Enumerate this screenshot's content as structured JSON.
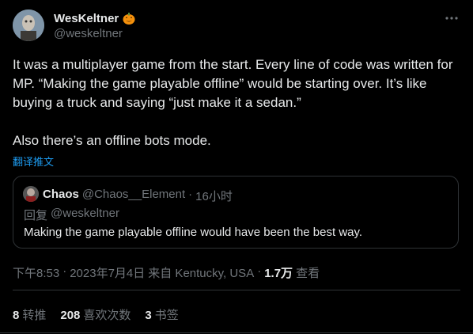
{
  "author": {
    "display_name": "WesKeltner",
    "handle": "@weskeltner",
    "badge_icon": "pumpkin-icon"
  },
  "tweet": {
    "text": "It was a multiplayer game from the start. Every line of code was written for MP. “Making the game playable offline” would be starting over. It’s like buying a truck and saying “just make it a sedan.”\n\nAlso there’s an offline bots mode.",
    "translate_label": "翻译推文"
  },
  "quote": {
    "display_name": "Chaos",
    "handle": "@Chaos__Element",
    "separator": "·",
    "time": "16小时",
    "reply_prefix": "回复",
    "reply_to": "@weskeltner",
    "text": "Making the game playable offline would have been the best way."
  },
  "meta": {
    "time": "下午8:53",
    "sep1": "·",
    "date": "2023年7月4日",
    "location": "来自 Kentucky, USA",
    "sep2": "·",
    "views": "1.7万",
    "views_label": "查看"
  },
  "stats": {
    "retweets": "8",
    "retweets_label": "转推",
    "likes": "208",
    "likes_label": "喜欢次数",
    "bookmarks": "3",
    "bookmarks_label": "书签"
  },
  "colors": {
    "background": "#000000",
    "text": "#e7e9ea",
    "secondary": "#71767b",
    "link": "#1d9bf0",
    "border": "#2f3336"
  }
}
